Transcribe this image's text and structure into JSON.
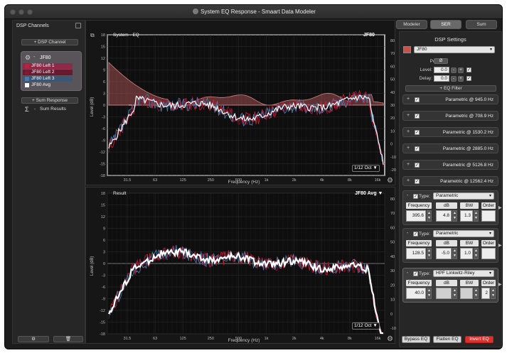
{
  "window": {
    "title": "System EQ Response - Smaart Data Modeler"
  },
  "left_panel": {
    "title": "DSP Channels",
    "add_channel": "+ DSP Channel",
    "group": {
      "name": "JF80",
      "channels": [
        {
          "label": "JF80 Left 1",
          "color": "#c0203a"
        },
        {
          "label": "JF80 Left 2",
          "color": "#8a1530"
        },
        {
          "label": "JF80 Left 3",
          "color": "#4a78a8"
        },
        {
          "label": "JF80 Avg",
          "color": "#ffffff"
        }
      ]
    },
    "add_sum": "+ Sum Response",
    "sum_results": "Sum Results"
  },
  "top_graph": {
    "title": "System - EQ",
    "tag": "JF80",
    "oct": "1/12 Oct",
    "xlabel": "Frequency (Hz)",
    "ylabel": "Level (dB)",
    "y_ticks": [
      "18",
      "15",
      "12",
      "9",
      "6",
      "3",
      "0",
      "-3",
      "-6",
      "-9",
      "-12",
      "-15",
      "-18"
    ],
    "y_ticks_right": [
      "80",
      "70",
      "60",
      "50",
      "40",
      "30",
      "20",
      "10",
      "0",
      "-10",
      "-20"
    ],
    "x_ticks": [
      "31.5",
      "63",
      "125",
      "250",
      "500",
      "1k",
      "2k",
      "4k",
      "8k",
      "16k"
    ]
  },
  "bottom_graph": {
    "title": "Result",
    "tag": "JF80 Avg",
    "oct": "1/12 Oct",
    "xlabel": "Frequency (Hz)",
    "ylabel": "Level (dB)",
    "y_ticks": [
      "18",
      "15",
      "12",
      "9",
      "6",
      "3",
      "0",
      "-3",
      "-6",
      "-9",
      "-12",
      "-15",
      "-18"
    ],
    "y_ticks_right": [
      "80",
      "70",
      "60",
      "50",
      "40",
      "30",
      "20",
      "10",
      "0",
      "-10"
    ],
    "x_ticks": [
      "31.5",
      "63",
      "125",
      "250",
      "500",
      "1k",
      "2k",
      "4k",
      "8k",
      "16k"
    ]
  },
  "tabs": [
    "Modeler",
    "SER",
    "Sum"
  ],
  "right_panel": {
    "title": "DSP Settings",
    "channel_select": "JF80",
    "polarity_label": "Polarity:",
    "polarity_symbol": "Ø",
    "level_label": "Level:",
    "level_value": "0.0",
    "delay_label": "Delay:",
    "delay_value": "0.0",
    "add_filter": "+ EQ Filter",
    "collapsed_filters": [
      "Parametric @ 945.0 Hz",
      "Parametric @ 708.9 Hz",
      "Parametric @ 1530.2 Hz",
      "Parametric @ 2885.0 Hz",
      "Parametric @ 5126.8 Hz",
      "Parametric @ 12562.4 Hz"
    ],
    "type_label": "Type:",
    "expanded_filters": [
      {
        "type": "Parametric",
        "headers": [
          "Frequency",
          "dB",
          "BW",
          "Order"
        ],
        "values": [
          "395.6",
          "4.8",
          "1.3",
          ""
        ]
      },
      {
        "type": "Parametric",
        "headers": [
          "Frequency",
          "dB",
          "BW",
          "Order"
        ],
        "values": [
          "128.5",
          "-5.0",
          "1.0",
          ""
        ]
      },
      {
        "type": "HPF Linkwitz-Riley",
        "headers": [
          "Frequency",
          "dB",
          "BW",
          "Order"
        ],
        "values": [
          "40.0",
          "",
          "",
          "2"
        ]
      }
    ],
    "bypass": "Bypass EQ",
    "flatten": "Flatten EQ",
    "invert": "Invert EQ"
  },
  "colors": {
    "accent_red": "#e0302d",
    "trace_red": "#c0203a",
    "trace_blue": "#4a78a8",
    "eq_fill": "#c06060"
  }
}
